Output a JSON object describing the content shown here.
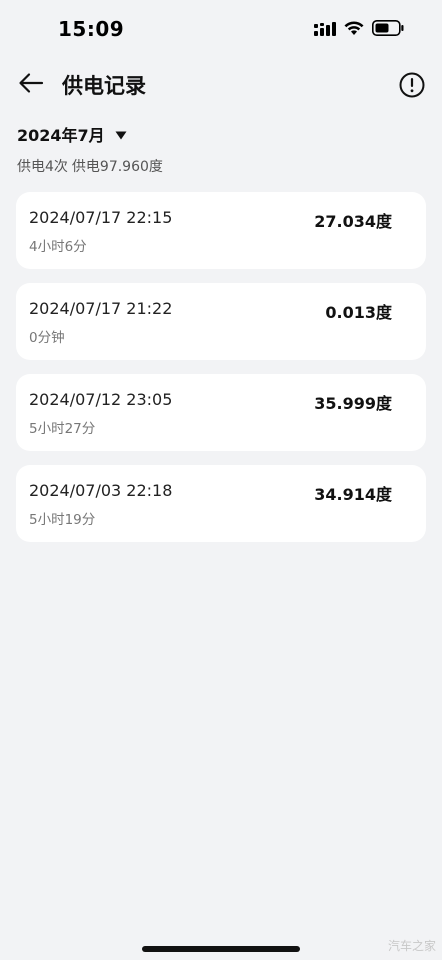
{
  "status_bar": {
    "time": "15:09"
  },
  "header": {
    "title": "供电记录",
    "icons": {
      "back": "back-arrow-icon",
      "info": "info-icon"
    }
  },
  "filter": {
    "month": "2024年7月"
  },
  "summary": {
    "count_text": "供电4次",
    "total_text": "供电97.960度"
  },
  "records": [
    {
      "datetime": "2024/07/17 22:15",
      "duration": "4小时6分",
      "energy": "27.034度"
    },
    {
      "datetime": "2024/07/17 21:22",
      "duration": "0分钟",
      "energy": "0.013度"
    },
    {
      "datetime": "2024/07/12 23:05",
      "duration": "5小时27分",
      "energy": "35.999度"
    },
    {
      "datetime": "2024/07/03 22:18",
      "duration": "5小时19分",
      "energy": "34.914度"
    }
  ],
  "watermark": "汽车之家"
}
